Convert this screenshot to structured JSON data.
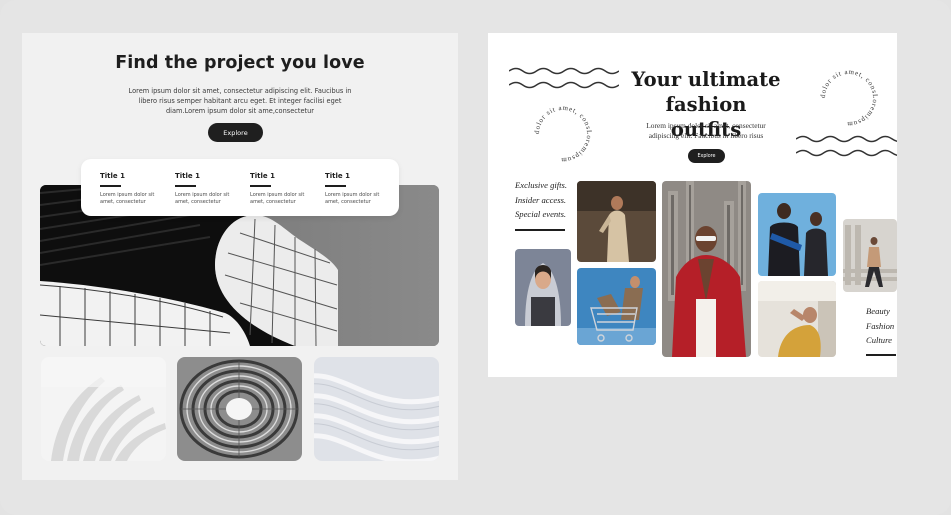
{
  "left": {
    "title": "Find the project you love",
    "description": "Lorem ipsum dolor sit amet, consectetur adipiscing elit. Faucibus in libero risus semper habitant arcu eget. Et integer facilisi eget diam.Lorem ipsum dolor sit ame,consectetur",
    "button": "Explore",
    "features": [
      {
        "title": "Title 1",
        "text": "Lorem ipsum dolor sit amet, consectetur"
      },
      {
        "title": "Title 1",
        "text": "Lorem ipsum dolor sit amet, consectetur"
      },
      {
        "title": "Title 1",
        "text": "Lorem ipsum dolor sit amet, consectetur"
      },
      {
        "title": "Title 1",
        "text": "Lorem ipsum dolor sit amet, consectetur"
      }
    ]
  },
  "right": {
    "title_line1": "Your ultimate",
    "title_line2": "fashion outfits",
    "description": "Lorem ipsum dolor sit amet, consectetur adipiscing elit. Faucibus in libero risus",
    "button": "Explore",
    "tagline": [
      "Exclusive gifts.",
      "Insider access.",
      "Special events."
    ],
    "categories": [
      "Beauty",
      "Fashion",
      "Culture"
    ],
    "circle_text": "dolor sit amet, consLoremipsum"
  },
  "colors": {
    "page_bg": "#e3e3e3",
    "left_panel_bg": "#f1f1f1",
    "right_panel_bg": "#ffffff",
    "button_bg": "#1f1f1f",
    "text_dark": "#1e1e1e"
  }
}
